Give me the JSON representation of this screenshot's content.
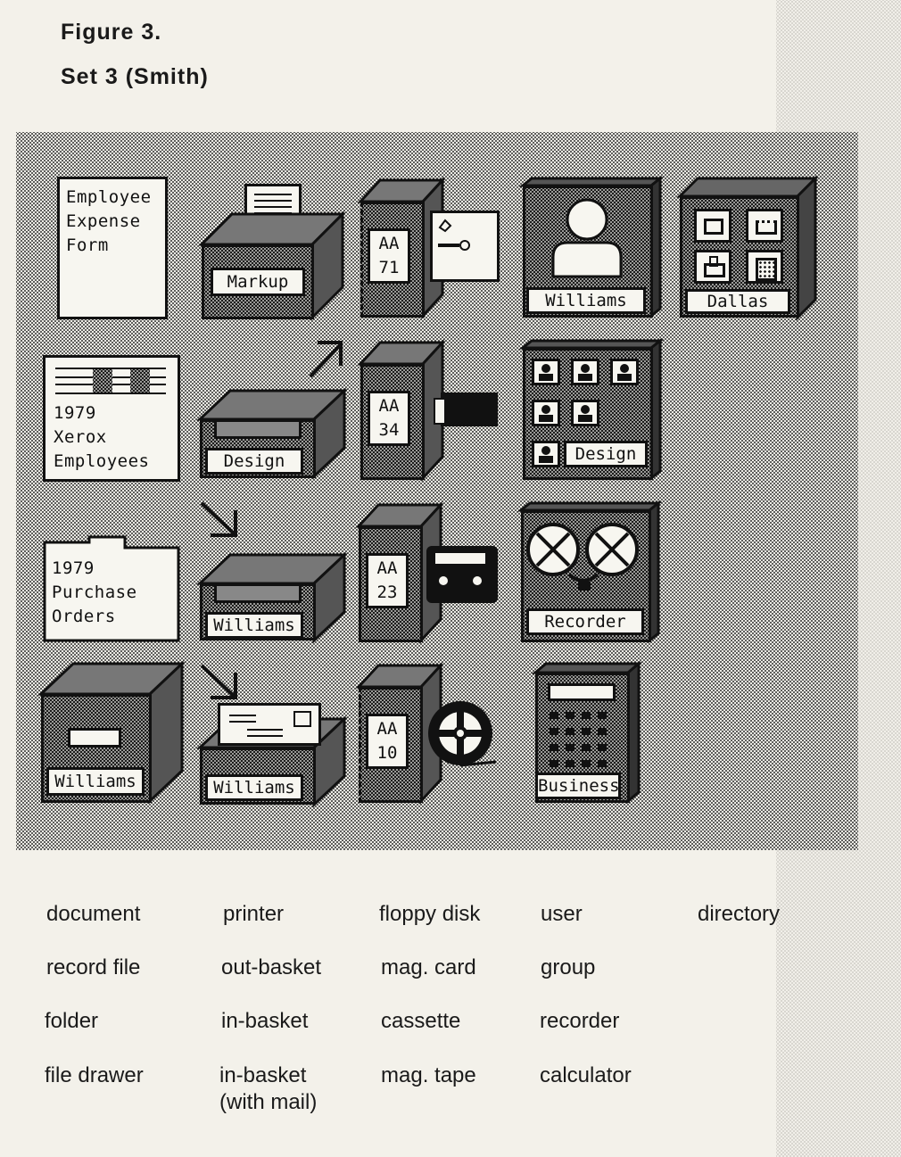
{
  "figure": {
    "title": "Figure 3.",
    "subtitle": "Set 3  (Smith)"
  },
  "icons": {
    "document_lines": "Employee\nExpense\nForm",
    "record_file_lines": "1979\nXerox\nEmployees",
    "folder_lines": "1979\nPurchase\nOrders",
    "file_drawer_label": "Williams",
    "printer_label": "Markup",
    "out_basket_label": "Design",
    "in_basket_label": "Williams",
    "in_basket_mail_label": "Williams",
    "floppy_label": "AA\n71",
    "mag_card_label": "AA\n34",
    "cassette_label": "AA\n23",
    "mag_tape_label": "AA\n10",
    "user_label": "Williams",
    "group_label": "Design",
    "recorder_label": "Recorder",
    "calculator_label": "Business",
    "directory_label": "Dallas"
  },
  "captions": {
    "col1": [
      "document",
      "record file",
      "folder",
      "file drawer"
    ],
    "col2": [
      "printer",
      "out-basket",
      "in-basket",
      "in-basket\n(with mail)"
    ],
    "col3": [
      "floppy disk",
      "mag. card",
      "cassette",
      "mag. tape"
    ],
    "col4": [
      "user",
      "group",
      "recorder",
      "calculator"
    ],
    "col5": [
      "directory"
    ]
  }
}
